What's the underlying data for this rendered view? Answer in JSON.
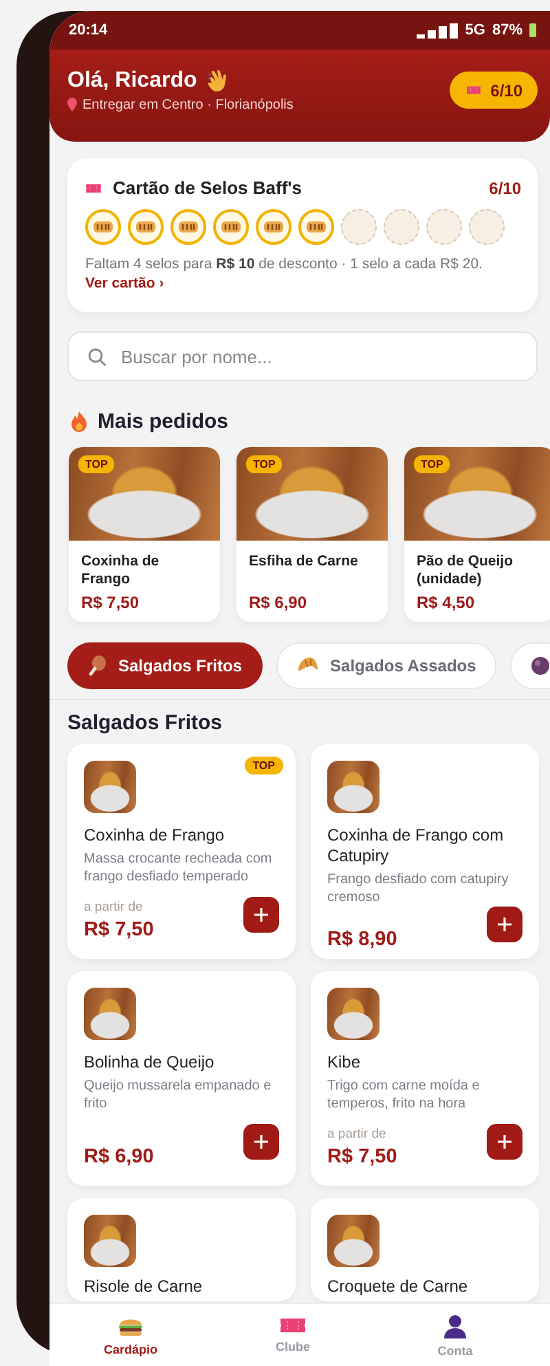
{
  "status_bar": {
    "time": "20:14",
    "network": "5G",
    "battery": "87%"
  },
  "header": {
    "greeting": "Olá, Ricardo",
    "location": "Entregar em Centro · Florianópolis",
    "stamps_badge": "6/10"
  },
  "stamp_card": {
    "title": "Cartão de Selos Baff's",
    "count": "6/10",
    "stamps": [
      {
        "filled": true
      },
      {
        "filled": true
      },
      {
        "filled": true
      },
      {
        "filled": true
      },
      {
        "filled": true
      },
      {
        "filled": true
      },
      {
        "filled": false
      },
      {
        "filled": false
      },
      {
        "filled": false
      },
      {
        "filled": false
      }
    ],
    "note": "Faltam 4 selos para **R$ 10** de desconto · 1 selo a cada R$ 20.",
    "link": "Ver cartão ›"
  },
  "search": {
    "placeholder": "Buscar por nome..."
  },
  "best_sellers": {
    "title": "Mais pedidos",
    "items": [
      {
        "badge": "TOP",
        "name": "Coxinha de Frango",
        "price": "R$ 7,50"
      },
      {
        "badge": "TOP",
        "name": "Esfiha de Carne",
        "price": "R$ 6,90"
      },
      {
        "badge": "TOP",
        "name": "Pão de Queijo (unidade)",
        "price": "R$ 4,50"
      }
    ]
  },
  "categories": [
    {
      "kind": "drumstick",
      "label": "Salgados Fritos",
      "selected": true
    },
    {
      "kind": "croissant",
      "label": "Salgados Assados",
      "selected": false
    },
    {
      "kind": "ball",
      "selected": false
    }
  ],
  "menu": {
    "title": "Salgados Fritos",
    "items": [
      {
        "name": "Coxinha de Frango",
        "description": "Massa crocante recheada com frango desfiado temperado",
        "badge": "TOP",
        "price_prefix": "a partir de",
        "price": "R$ 7,50"
      },
      {
        "name": "Coxinha de Frango com Catupiry",
        "description": "Frango desfiado com catupiry cremoso",
        "price": "R$ 8,90"
      },
      {
        "name": "Bolinha de Queijo",
        "description": "Queijo mussarela empanado e frito",
        "price": "R$ 6,90"
      },
      {
        "name": "Kibe",
        "description": "Trigo com carne moída e temperos, frito na hora",
        "price_prefix": "a partir de",
        "price": "R$ 7,50"
      },
      {
        "name": "Risole de Carne"
      },
      {
        "name": "Croquete de Carne"
      }
    ]
  },
  "nav": [
    {
      "kind": "burger",
      "label": "Cardápio",
      "selected": true
    },
    {
      "kind": "ticket",
      "label": "Clube",
      "selected": false
    },
    {
      "kind": "person",
      "label": "Conta",
      "selected": false
    }
  ]
}
